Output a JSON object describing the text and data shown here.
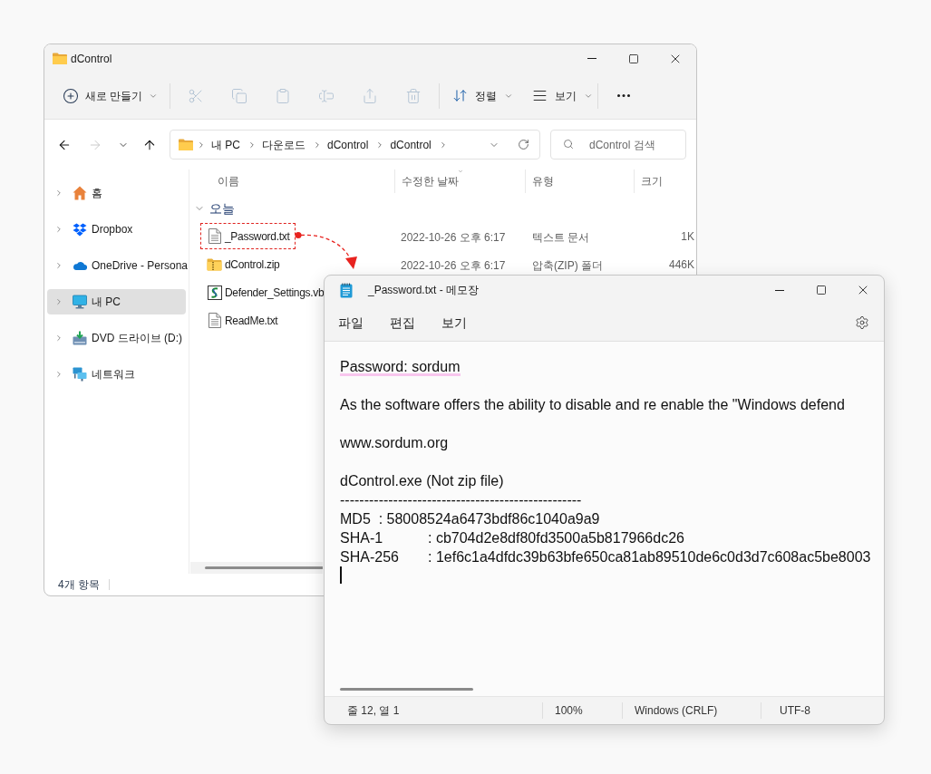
{
  "explorer": {
    "title": "dControl",
    "toolbar": {
      "new": {
        "label": "새로 만들기"
      },
      "actions": [
        {
          "disabled": true
        },
        {
          "disabled": true
        },
        {
          "disabled": true
        },
        {
          "disabled": true
        },
        {
          "disabled": true
        },
        {
          "disabled": true
        }
      ],
      "sort": {
        "label": "정렬"
      },
      "view": {
        "label": "보기"
      }
    },
    "nav_buttons": [
      {
        "disabled": false
      },
      {
        "disabled": true
      },
      {
        "disabled": false
      },
      {
        "disabled": false
      }
    ],
    "breadcrumbs": [
      "내 PC",
      "다운로드",
      "dControl",
      "dControl"
    ],
    "search": {
      "placeholder": "dControl 검색"
    },
    "sidebar": {
      "items": [
        {
          "label": "홈",
          "selected": false
        },
        {
          "label": "Dropbox",
          "selected": false
        },
        {
          "label": "OneDrive - Persona",
          "selected": false
        },
        {
          "label": "내 PC",
          "selected": true
        },
        {
          "label": "DVD 드라이브 (D:)",
          "selected": false
        },
        {
          "label": "네트워크",
          "selected": false
        }
      ]
    },
    "columns": [
      {
        "label": "이름",
        "sorted": false
      },
      {
        "label": "수정한 날짜",
        "sorted": true
      },
      {
        "label": "유형",
        "sorted": false
      },
      {
        "label": "크기",
        "sorted": false
      }
    ],
    "group": {
      "label": "오늘",
      "expanded": true
    },
    "files": [
      {
        "kind": "text",
        "name": "_Password.txt",
        "modified": "2022-10-26 오후 6:17",
        "type": "텍스트 문서",
        "size": "1K",
        "highlighted": true
      },
      {
        "kind": "zip",
        "name": "dControl.zip",
        "modified": "2022-10-26 오후 6:17",
        "type": "압축(ZIP) 폴더",
        "size": "446K",
        "highlighted": false
      },
      {
        "kind": "script",
        "name": "Defender_Settings.vb",
        "highlighted": false
      },
      {
        "kind": "text",
        "name": "ReadMe.txt",
        "highlighted": false
      }
    ],
    "status_bar": "4개 항목"
  },
  "notepad": {
    "title": "_Password.txt - 메모장",
    "menu": [
      "파일",
      "편집",
      "보기"
    ],
    "lines": [
      {
        "kind": "text",
        "text": "Password: sordum",
        "highlighted": true
      },
      {
        "kind": "blank"
      },
      {
        "kind": "text",
        "text": "As the software offers the ability to disable and re enable the \"Windows defend",
        "highlighted": false
      },
      {
        "kind": "blank"
      },
      {
        "kind": "text",
        "text": "www.sordum.org",
        "highlighted": false
      },
      {
        "kind": "blank"
      },
      {
        "kind": "text",
        "text": "dControl.exe (Not zip file)",
        "highlighted": false
      },
      {
        "kind": "text",
        "text": "--------------------------------------------------",
        "highlighted": false
      },
      {
        "kind": "text",
        "text": "MD5  : 58008524a6473bdf86c1040a9a9",
        "highlighted": false
      },
      {
        "kind": "text",
        "text": "SHA-1\t: cb704d2e8df80fd3500a5b817966dc26",
        "highlighted": false
      },
      {
        "kind": "text",
        "text": "SHA-256\t: 1ef6c1a4dfdc39b63bfe650ca81ab89510de6c0d3d7c608ac5be8003",
        "highlighted": false
      },
      {
        "kind": "caret"
      }
    ],
    "status_bar": [
      "줄 12, 열 1",
      "100%",
      "Windows (CRLF)",
      "UTF-8"
    ]
  }
}
